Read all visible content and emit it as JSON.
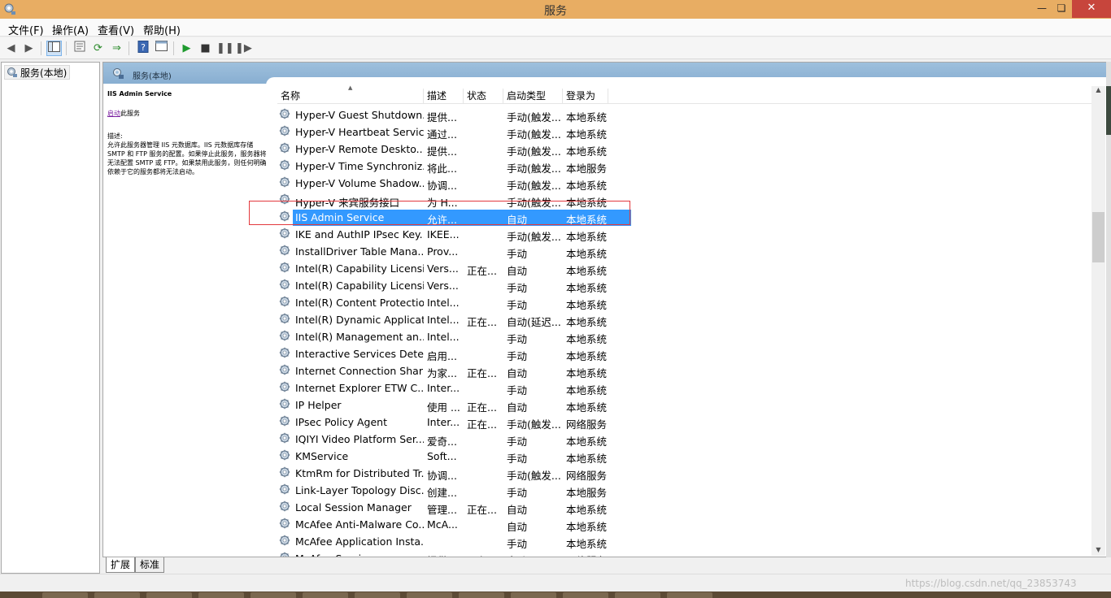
{
  "window": {
    "title": "服务"
  },
  "menu": [
    "文件(F)",
    "操作(A)",
    "查看(V)",
    "帮助(H)"
  ],
  "toolbar_icons": [
    "back-icon",
    "forward-icon",
    "console-tree-icon",
    "properties-icon",
    "refresh-icon",
    "export-icon",
    "help-icon",
    "view-icon",
    "play-icon",
    "stop-icon",
    "pause-icon",
    "restart-icon"
  ],
  "tree": {
    "root_label": "服务(本地)"
  },
  "panel": {
    "header_title": "服务(本地)",
    "selected_service": "IIS Admin Service",
    "start_link": "启动",
    "start_suffix": "此服务",
    "desc_label": "描述:",
    "description": "允许此服务器管理 IIS 元数据库。IIS 元数据库存储 SMTP 和 FTP 服务的配置。如果停止此服务，服务器将无法配置 SMTP 或 FTP。如果禁用此服务，则任何明确依赖于它的服务都将无法启动。"
  },
  "columns": [
    "名称",
    "描述",
    "状态",
    "启动类型",
    "登录为"
  ],
  "rows": [
    {
      "name": "Hyper-V Guest Shutdown...",
      "desc": "提供...",
      "status": "",
      "startup": "手动(触发...",
      "logon": "本地系统"
    },
    {
      "name": "Hyper-V Heartbeat Service",
      "desc": "通过...",
      "status": "",
      "startup": "手动(触发...",
      "logon": "本地系统"
    },
    {
      "name": "Hyper-V Remote Deskto...",
      "desc": "提供...",
      "status": "",
      "startup": "手动(触发...",
      "logon": "本地系统"
    },
    {
      "name": "Hyper-V Time Synchroniz...",
      "desc": "将此...",
      "status": "",
      "startup": "手动(触发...",
      "logon": "本地服务"
    },
    {
      "name": "Hyper-V Volume Shadow...",
      "desc": "协调...",
      "status": "",
      "startup": "手动(触发...",
      "logon": "本地系统"
    },
    {
      "name": "Hyper-V 来宾服务接口",
      "desc": "为 H...",
      "status": "",
      "startup": "手动(触发...",
      "logon": "本地系统"
    },
    {
      "name": "IIS Admin Service",
      "desc": "允许...",
      "status": "",
      "startup": "自动",
      "logon": "本地系统"
    },
    {
      "name": "IKE and AuthIP IPsec Key...",
      "desc": "IKEE...",
      "status": "",
      "startup": "手动(触发...",
      "logon": "本地系统"
    },
    {
      "name": "InstallDriver Table Mana...",
      "desc": "Prov...",
      "status": "",
      "startup": "手动",
      "logon": "本地系统"
    },
    {
      "name": "Intel(R) Capability Licensi...",
      "desc": "Vers...",
      "status": "正在...",
      "startup": "自动",
      "logon": "本地系统"
    },
    {
      "name": "Intel(R) Capability Licensi...",
      "desc": "Vers...",
      "status": "",
      "startup": "手动",
      "logon": "本地系统"
    },
    {
      "name": "Intel(R) Content Protectio...",
      "desc": "Intel...",
      "status": "",
      "startup": "手动",
      "logon": "本地系统"
    },
    {
      "name": "Intel(R) Dynamic Applicat...",
      "desc": "Intel...",
      "status": "正在...",
      "startup": "自动(延迟...",
      "logon": "本地系统"
    },
    {
      "name": "Intel(R) Management an...",
      "desc": "Intel...",
      "status": "",
      "startup": "手动",
      "logon": "本地系统"
    },
    {
      "name": "Interactive Services Dete...",
      "desc": "启用...",
      "status": "",
      "startup": "手动",
      "logon": "本地系统"
    },
    {
      "name": "Internet Connection Shari...",
      "desc": "为家...",
      "status": "正在...",
      "startup": "自动",
      "logon": "本地系统"
    },
    {
      "name": "Internet Explorer ETW C...",
      "desc": "Inter...",
      "status": "",
      "startup": "手动",
      "logon": "本地系统"
    },
    {
      "name": "IP Helper",
      "desc": "使用 ...",
      "status": "正在...",
      "startup": "自动",
      "logon": "本地系统"
    },
    {
      "name": "IPsec Policy Agent",
      "desc": "Inter...",
      "status": "正在...",
      "startup": "手动(触发...",
      "logon": "网络服务"
    },
    {
      "name": "IQIYI Video Platform Ser...",
      "desc": "爱奇...",
      "status": "",
      "startup": "手动",
      "logon": "本地系统"
    },
    {
      "name": "KMService",
      "desc": "Soft...",
      "status": "",
      "startup": "手动",
      "logon": "本地系统"
    },
    {
      "name": "KtmRm for Distributed Tr...",
      "desc": "协调...",
      "status": "",
      "startup": "手动(触发...",
      "logon": "网络服务"
    },
    {
      "name": "Link-Layer Topology Disc...",
      "desc": "创建...",
      "status": "",
      "startup": "手动",
      "logon": "本地服务"
    },
    {
      "name": "Local Session Manager",
      "desc": "管理...",
      "status": "正在...",
      "startup": "自动",
      "logon": "本地系统"
    },
    {
      "name": "McAfee Anti-Malware Co...",
      "desc": "McA...",
      "status": "",
      "startup": "自动",
      "logon": "本地系统"
    },
    {
      "name": "McAfee Application Insta...",
      "desc": "",
      "status": "",
      "startup": "手动",
      "logon": "本地系统"
    },
    {
      "name": "McAfee Service...",
      "desc": "提供...",
      "status": "正在...",
      "startup": "自动",
      "logon": "网络服务"
    }
  ],
  "selected_index": 6,
  "tabs": [
    "扩展",
    "标准"
  ],
  "watermark": "https://blog.csdn.net/qq_23853743",
  "colors": {
    "titlebar": "#e8ad63",
    "selection": "#3399ff",
    "highlight_box": "#e3393d",
    "close": "#c7453c"
  }
}
